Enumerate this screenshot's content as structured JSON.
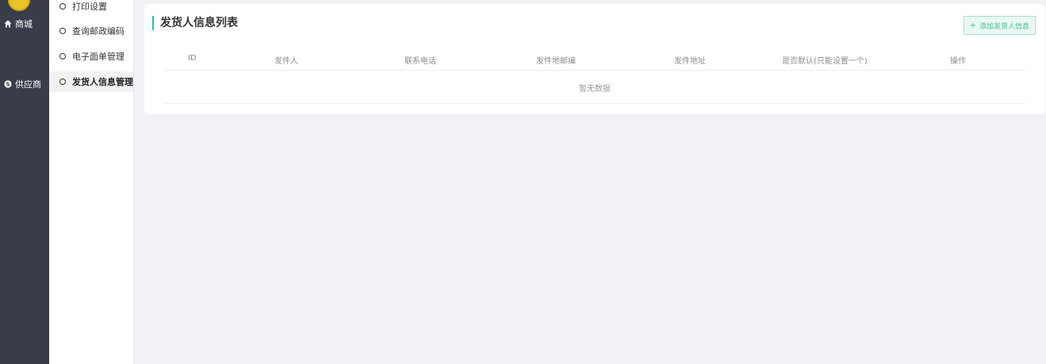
{
  "sidebar": {
    "items": [
      {
        "label": "商城",
        "icon": "home-icon"
      },
      {
        "label": "供应商",
        "icon": "supplier-icon"
      }
    ]
  },
  "submenu": {
    "items": [
      {
        "label": "打印设置"
      },
      {
        "label": "查询邮政编码"
      },
      {
        "label": "电子面单管理"
      },
      {
        "label": "发货人信息管理",
        "active": true
      }
    ]
  },
  "main": {
    "title": "发货人信息列表",
    "add_button": "添加发货人信息",
    "table": {
      "columns": [
        "ID",
        "发件人",
        "联系电话",
        "发件地邮编",
        "发件地址",
        "是否默认(只能设置一个)",
        "操作"
      ],
      "empty_text": "暂无数据"
    }
  },
  "colors": {
    "sidebar_bg": "#393d49",
    "accent": "#2fb8c4",
    "add_button_text": "#3fbf8a"
  }
}
